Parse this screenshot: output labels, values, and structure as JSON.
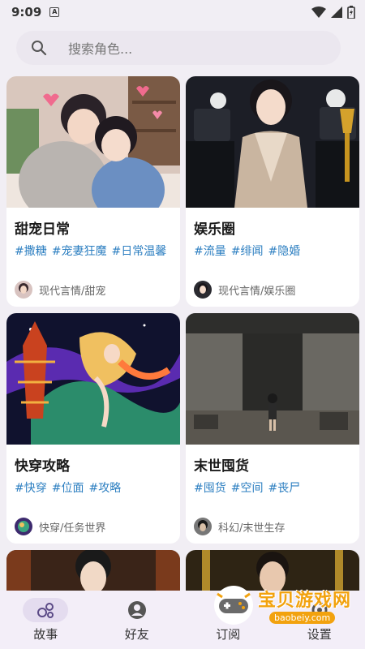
{
  "status": {
    "time": "9:09",
    "app_badge": "A"
  },
  "search": {
    "placeholder": "搜索角色..."
  },
  "cards": [
    {
      "title": "甜宠日常",
      "tags": [
        "#撒糖",
        "#宠妻狂魔",
        "#日常温馨"
      ],
      "category": "现代言情/甜宠"
    },
    {
      "title": "娱乐圈",
      "tags": [
        "#流量",
        "#绯闻",
        "#隐婚"
      ],
      "category": "现代言情/娱乐圈"
    },
    {
      "title": "快穿攻略",
      "tags": [
        "#快穿",
        "#位面",
        "#攻略"
      ],
      "category": "快穿/任务世界"
    },
    {
      "title": "末世囤货",
      "tags": [
        "#囤货",
        "#空间",
        "#丧尸"
      ],
      "category": "科幻/末世生存"
    }
  ],
  "nav": [
    {
      "label": "故事"
    },
    {
      "label": "好友"
    },
    {
      "label": "订阅"
    },
    {
      "label": "设置"
    }
  ],
  "watermark": {
    "text": "宝贝游戏网",
    "url": "baobeiy.com"
  },
  "colors": {
    "accent": "#5b4a86",
    "tag": "#2d7fc1",
    "background": "#f1eef4"
  }
}
